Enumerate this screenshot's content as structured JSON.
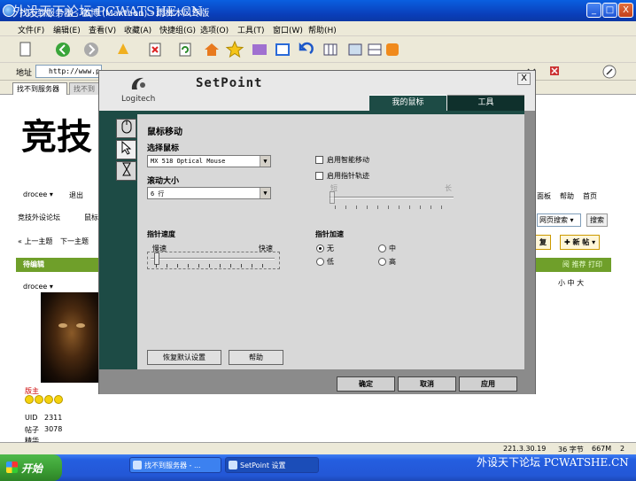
{
  "browser": {
    "title": "找不到服务器 - 微博 (Maxthon) - 雨林木风专版",
    "watermark": "外设天下论坛 PCWATSHE.CN",
    "minimize": "_",
    "maximize": "□",
    "close": "X",
    "menu": [
      "文件(F)",
      "编辑(E)",
      "查看(V)",
      "收藏(A)",
      "快捷组(G)",
      "选项(O)",
      "工具(T)",
      "窗口(W)",
      "帮助(H)"
    ],
    "address_label": "地址",
    "address_value": "http://www.pcw",
    "tab_active": "找不到服务器",
    "tab_inactive": "找不到"
  },
  "webpage": {
    "big_logo": "竞技",
    "user_link": "drocee",
    "logout": "退出",
    "forum": "竞技外设论坛",
    "crumb": "鼠标",
    "prev_topic": "上一主题",
    "next_topic": "下一主题",
    "right_links": [
      "面板",
      "帮助",
      "首页"
    ],
    "search_select": "网页搜索",
    "search_btn": "搜索",
    "reply_btn": "复",
    "new_post_btn": "新 帖",
    "green_bar_left": "待编辑",
    "green_bar_right": "阅  推荐  打印",
    "font_size": "小 中 大",
    "poster": "drocee",
    "role": "版主",
    "uid_label": "UID",
    "uid": "2311",
    "posts_label": "帖子",
    "posts": "3078",
    "more_label": "精华"
  },
  "statusbar": {
    "ip": "221.3.30.19",
    "chars": "36 字节",
    "mem": "667M",
    "pages": "2"
  },
  "taskbar": {
    "start": "开始",
    "task1": "找不到服务器 - ...",
    "task2": "SetPoint 设置",
    "watermark": "外设天下论坛 PCWATSHE.CN"
  },
  "setpoint": {
    "brand": "Logitech",
    "title": "SetPoint",
    "close": "X",
    "tabs": {
      "mouse": "我的鼠标",
      "tools": "工具"
    },
    "side_icons": [
      "mouse-icon",
      "pointer-icon",
      "hourglass-icon"
    ],
    "section_title": "鼠标移动",
    "select_mouse_label": "选择鼠标",
    "mouse_value": "MX 518 Optical Mouse",
    "scroll_label": "滚动大小",
    "scroll_value": "6 行",
    "smart_move": "启用智能移动",
    "pointer_trail": "启用指针轨迹",
    "trail_short": "短",
    "trail_long": "长",
    "speed_label": "指针速度",
    "speed_slow": "慢速",
    "speed_fast": "快速",
    "speed_level": 0.03,
    "accel_label": "指针加速",
    "accel_options": [
      "无",
      "中",
      "低",
      "高"
    ],
    "accel_selected": "无",
    "restore_btn": "恢复默认设置",
    "help_btn": "帮助",
    "ok_btn": "确定",
    "cancel_btn": "取消",
    "apply_btn": "应用"
  }
}
